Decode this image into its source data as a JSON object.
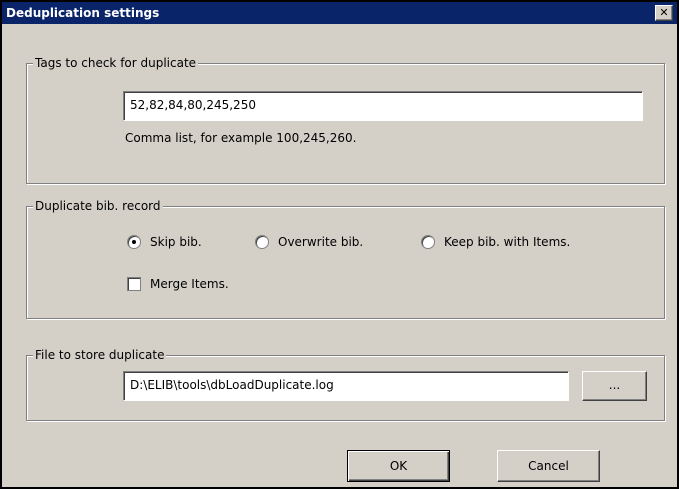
{
  "dialog": {
    "title": "Deduplication settings",
    "close_glyph": "✕",
    "close_icon": "close-icon"
  },
  "tags_group": {
    "label": "Tags to check for duplicate",
    "value": "52,82,84,80,245,250",
    "hint": "Comma list, for example 100,245,260."
  },
  "bib_group": {
    "label": "Duplicate bib. record",
    "options": [
      {
        "label": "Skip bib.",
        "checked": true
      },
      {
        "label": "Overwrite bib.",
        "checked": false
      },
      {
        "label": "Keep bib. with Items.",
        "checked": false
      }
    ],
    "merge_label": "Merge Items.",
    "merge_checked": false
  },
  "file_group": {
    "label": "File to store duplicate",
    "value": "D:\\ELIB\\tools\\dbLoadDuplicate.log",
    "browse_label": "..."
  },
  "buttons": {
    "ok_label": "OK",
    "cancel_label": "Cancel"
  },
  "colors": {
    "titlebar": "#0a246a",
    "face": "#d4d0c8"
  }
}
